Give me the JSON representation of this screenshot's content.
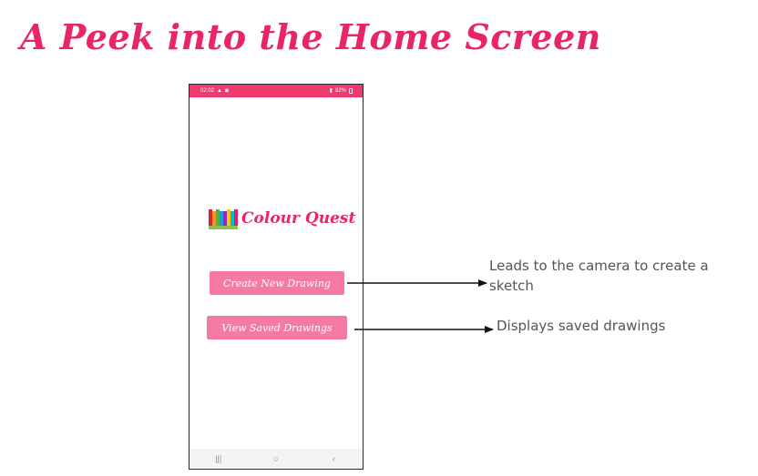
{
  "slide": {
    "title": "A Peek into the Home Screen"
  },
  "phone": {
    "status_bar": {
      "time": "02:02",
      "battery": "82%",
      "color": "#ef3a6e"
    },
    "app": {
      "logo_icon": "book-icon",
      "name": "Colour Quest"
    },
    "buttons": {
      "create_label": "Create New Drawing",
      "view_label": "View Saved Drawings",
      "color": "#f57aa3"
    },
    "nav_bar": {
      "recents_glyph": "|||",
      "home_glyph": "○",
      "back_glyph": "‹"
    }
  },
  "annotations": {
    "create": "Leads to the camera to create a sketch",
    "view": "Displays saved drawings"
  },
  "colors": {
    "accent": "#e8246a",
    "annotation_text": "#555555"
  }
}
